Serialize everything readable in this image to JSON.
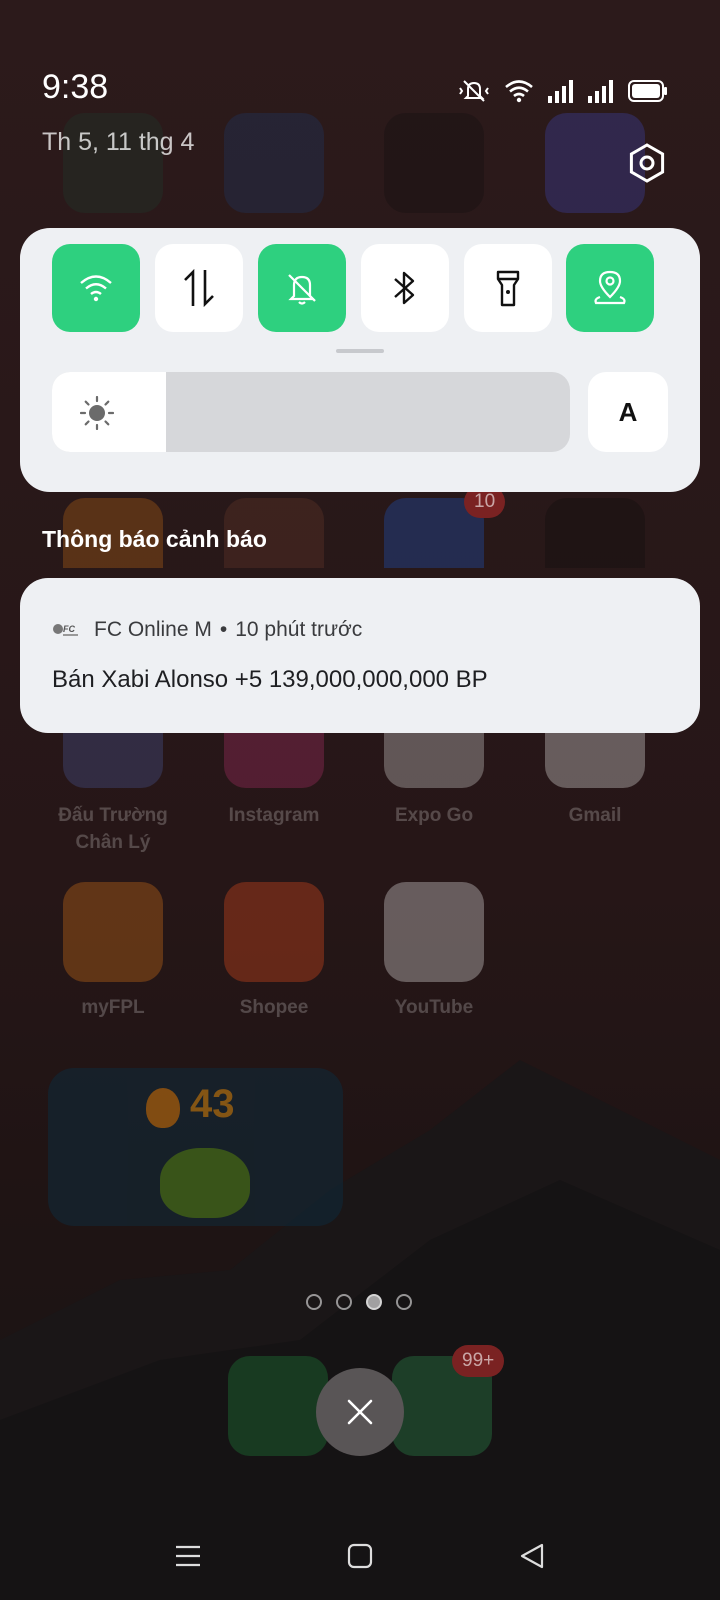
{
  "status_bar": {
    "time": "9:38",
    "date": "Th 5, 11 thg 4"
  },
  "quick_settings": {
    "tiles": [
      {
        "id": "wifi",
        "icon": "wifi-icon",
        "on": true
      },
      {
        "id": "mobile-data",
        "icon": "data-arrows-icon",
        "on": false
      },
      {
        "id": "dnd",
        "icon": "bell-off-icon",
        "on": true
      },
      {
        "id": "bluetooth",
        "icon": "bluetooth-icon",
        "on": false
      },
      {
        "id": "flashlight",
        "icon": "flashlight-icon",
        "on": false
      },
      {
        "id": "location",
        "icon": "location-pin-icon",
        "on": true
      }
    ],
    "brightness_level": 0.22,
    "auto_brightness_label": "A"
  },
  "notifications": {
    "section_title": "Thông báo cảnh báo",
    "items": [
      {
        "app_name": "FC Online M",
        "separator": "•",
        "time": "10 phút trước",
        "message": "Bán Xabi Alonso +5 139,000,000,000 BP"
      }
    ]
  },
  "home_screen": {
    "apps": [
      {
        "label": "Đấu Trường Chân Lý"
      },
      {
        "label": "Instagram"
      },
      {
        "label": "Expo Go"
      },
      {
        "label": "Gmail"
      },
      {
        "label": "myFPL"
      },
      {
        "label": "Shopee"
      },
      {
        "label": "YouTube"
      }
    ],
    "badges": {
      "zalo": "10",
      "messages": "99+"
    },
    "widget_streak": "43",
    "page_count": 4,
    "active_page": 3
  },
  "colors": {
    "tile_on": "#2ed07f",
    "panel_bg": "#eef0f3",
    "wallpaper": "#2a1a1b"
  }
}
